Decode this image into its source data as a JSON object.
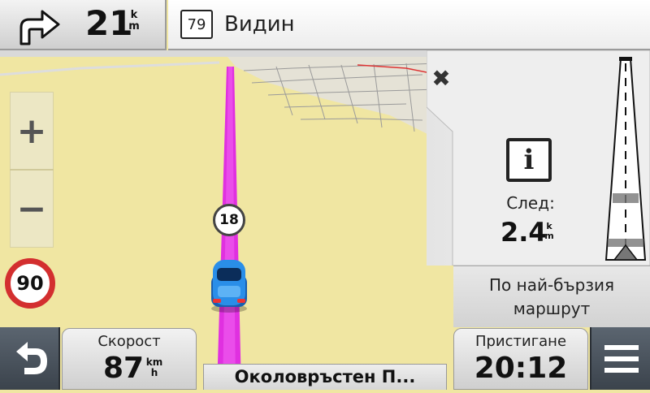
{
  "turn_panel": {
    "icon": "turn-right-arrow-icon",
    "distance": "21",
    "unit_top": "k",
    "unit_bottom": "m"
  },
  "street_panel": {
    "route_number": "79",
    "name": "Видин"
  },
  "map": {
    "zoom_in_label": "+",
    "zoom_out_label": "−",
    "speed_limit": "90",
    "route_badge": "18",
    "route_color": "#e030e0",
    "land_color": "#f0e6a2"
  },
  "info_panel": {
    "close_label": "✖",
    "icon": "info-icon",
    "icon_label": "i",
    "next_label": "След:",
    "next_distance": "2.4",
    "unit_top": "k",
    "unit_bottom": "m"
  },
  "route_type": {
    "line1": "По най-бързия",
    "line2": "маршрут"
  },
  "bottom_bar": {
    "speed_label": "Скорост",
    "speed_value": "87",
    "speed_unit_top": "km",
    "speed_unit_bottom": "h",
    "road_name": "Околовръстен П...",
    "arrival_label": "Пристигане",
    "arrival_value": "20:12"
  }
}
